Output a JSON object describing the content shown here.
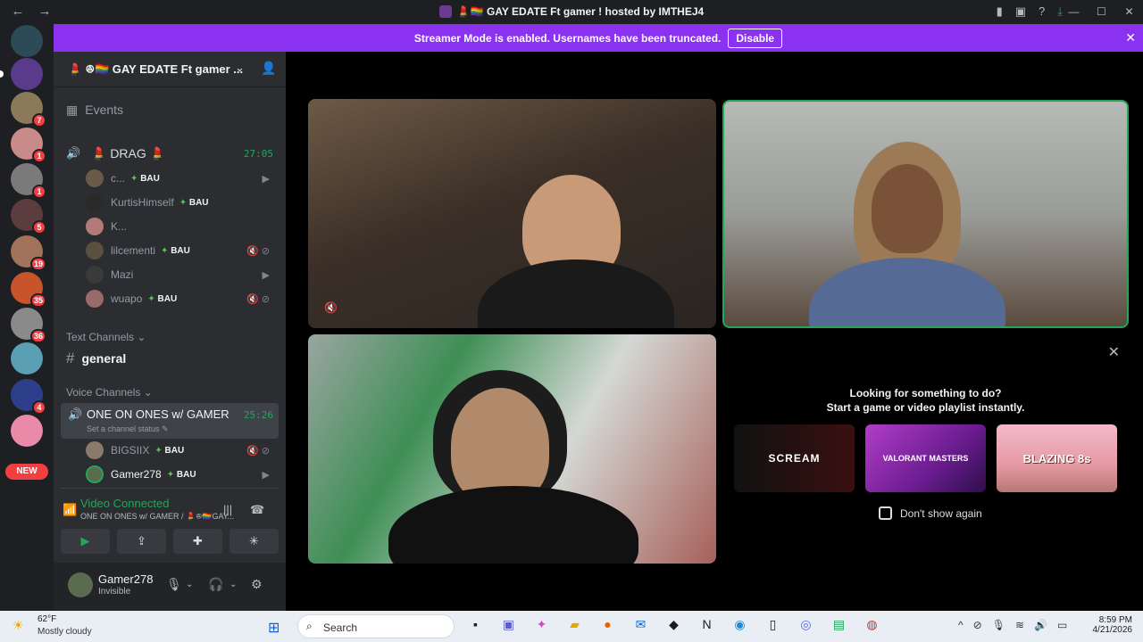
{
  "window": {
    "title": "💄🏳️‍🌈 GAY EDATE Ft gamer ! hosted by IMTHEJ4",
    "nav": [
      "←",
      "→"
    ],
    "tools": [
      "bookmark-icon",
      "inbox-icon",
      "help-icon",
      "download-icon"
    ],
    "controls": [
      "—",
      "☐",
      "✕"
    ]
  },
  "guild_badges": [
    "",
    "",
    "7",
    "1",
    "1",
    "5",
    "19",
    "",
    "35",
    "36",
    "",
    "4",
    "",
    ""
  ],
  "guild_new_label": "NEW",
  "banner": {
    "text": "Streamer Mode is enabled. Usernames have been truncated.",
    "button": "Disable"
  },
  "server": {
    "name": "💄 ꔮ🏳️‍🌈 GAY EDATE Ft gamer ...",
    "events_label": "Events"
  },
  "voice_channel_drag": {
    "name": "💄 DRAG 💄",
    "time": "27:05",
    "members": [
      {
        "name": "c...",
        "tag": "BAU",
        "icon": "▶"
      },
      {
        "name": "KurtisHimself",
        "tag": "BAU",
        "icon": ""
      },
      {
        "name": "K...",
        "tag": "",
        "icon": ""
      },
      {
        "name": "lilcementi",
        "tag": "BAU",
        "icon": "🔇 ⊘"
      },
      {
        "name": "Mazi",
        "tag": "",
        "icon": "▶"
      },
      {
        "name": "wuapo",
        "tag": "BAU",
        "icon": "🔇 ⊘"
      }
    ]
  },
  "text_channels": {
    "header": "Text Channels ⌄",
    "items": [
      {
        "name": "general"
      }
    ]
  },
  "voice_channels": {
    "header": "Voice Channels ⌄",
    "active": {
      "name": "ONE ON ONES w/ GAMER",
      "time": "25:26",
      "status": "Set a channel status ✎"
    },
    "members": [
      {
        "name": "BIGSIIX",
        "tag": "BAU",
        "icon": "🔇 ⊘"
      },
      {
        "name": "Gamer278",
        "tag": "BAU",
        "icon": "▶"
      }
    ]
  },
  "voice_panel": {
    "title": "Video Connected",
    "subtitle": "ONE ON ONES w/ GAMER / 💄ꔮ🏳️‍🌈GAY...",
    "buttons": [
      "▶",
      "⇪",
      "✚",
      "✳"
    ]
  },
  "user": {
    "name": "Gamer278",
    "status": "Invisible"
  },
  "activity": {
    "line1": "Looking for something to do?",
    "line2": "Start a game or video playlist instantly.",
    "cards": [
      "SCREAM",
      "VALORANT MASTERS",
      "BLAZING 8s"
    ],
    "checkbox_label": "Don't show again"
  },
  "taskbar": {
    "weather_temp": "62°F",
    "weather_cond": "Mostly cloudy",
    "search_placeholder": "Search",
    "time": "8:59 PM",
    "date": "4/21/2026"
  },
  "colors": {
    "brand": "#8b31f0",
    "online": "#23a55a",
    "danger": "#f23f42"
  }
}
